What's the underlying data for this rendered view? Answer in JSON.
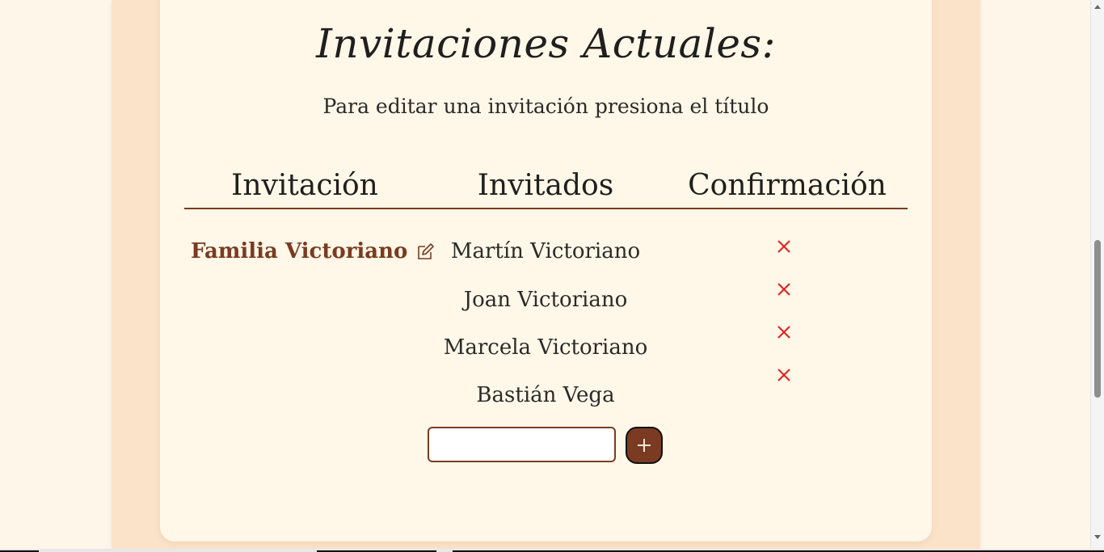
{
  "card": {
    "title": "Invitaciones Actuales:",
    "subtitle": "Para editar una invitación presiona el título"
  },
  "table": {
    "headers": [
      "Invitación",
      "Invitados",
      "Confirmación"
    ],
    "invitation": {
      "name": "Familia Victoriano",
      "edit_icon": "edit-icon"
    },
    "guests": [
      {
        "name": "Martín Victoriano",
        "confirmed": false
      },
      {
        "name": "Joan Victoriano",
        "confirmed": false
      },
      {
        "name": "Marcela Victoriano",
        "confirmed": false
      },
      {
        "name": "Bastián Vega",
        "confirmed": false
      }
    ]
  },
  "add_guest": {
    "input_value": "",
    "button_icon": "plus-icon"
  },
  "colors": {
    "accent": "#7a3b22",
    "cross": "#e02020",
    "card_bg": "#fff7e7",
    "column_bg": "#fbe3c9"
  }
}
